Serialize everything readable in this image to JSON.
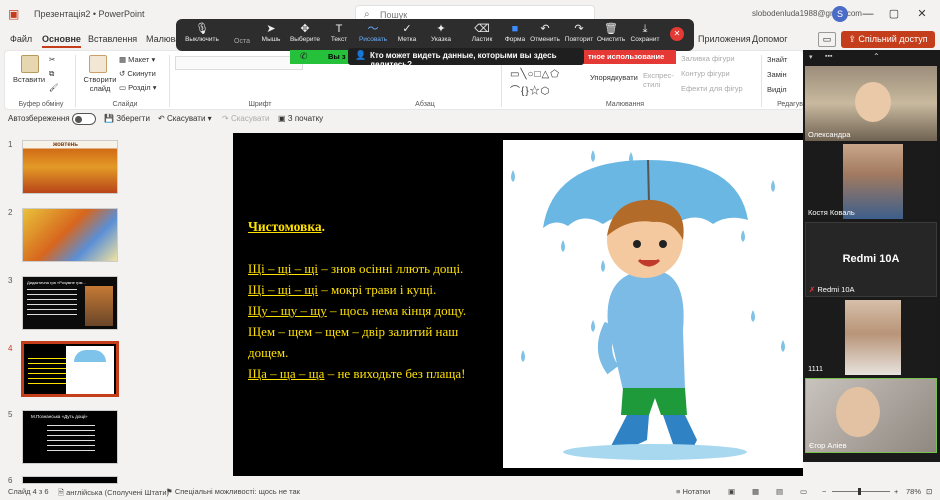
{
  "titlebar": {
    "doc_title": "Презентація2 • PowerPoint",
    "search_placeholder": "Пошук",
    "user_email": "slobodenluda1988@gmail.com",
    "avatar_letter": "S",
    "minimize": "—",
    "maximize": "▢",
    "close": "✕"
  },
  "tabs": [
    "Файл",
    "Основне",
    "Вставлення",
    "Малюва",
    "Приложения",
    "Допомог"
  ],
  "tabs_partial": {
    "ostavit": "Оста",
    "vyklyuchyty": "Выключить"
  },
  "share_label": "Спільний доступ",
  "comment_icon": "comment-icon",
  "zoom_toolbar": {
    "items": [
      {
        "label": "Мышь",
        "icon": "cursor-icon"
      },
      {
        "label": "Выберите",
        "icon": "move-icon"
      },
      {
        "label": "Текст",
        "icon": "text-icon"
      },
      {
        "label": "Рисовать",
        "icon": "draw-icon"
      },
      {
        "label": "Метка",
        "icon": "checkmark-icon"
      },
      {
        "label": "Указка",
        "icon": "pointer-icon"
      },
      {
        "label": "Ластик",
        "icon": "eraser-icon"
      },
      {
        "label": "Форма",
        "icon": "shape-icon"
      },
      {
        "label": "Отменить",
        "icon": "undo-icon"
      },
      {
        "label": "Повторит",
        "icon": "redo-icon"
      },
      {
        "label": "Очистить",
        "icon": "trash-icon"
      },
      {
        "label": "Сохранит",
        "icon": "save-icon"
      }
    ],
    "question": "Кто может видеть данные, которыми вы здесь делитесь?",
    "green_text": "Вы з",
    "red_text": "тное использование"
  },
  "ribbon": {
    "paste": "Вставити",
    "clipboard_label": "Буфер обміну",
    "new_slide": "Створити слайд",
    "layout": "Макет",
    "reset": "Скинути",
    "section": "Розділ",
    "slides_label": "Слайди",
    "font_label": "Шрифт",
    "paragraph_label": "Абзац",
    "arrange": "Упорядкувати",
    "express_styles": "Експрес-стилі",
    "drawing_label": "Малювання",
    "fill": "Заливка фігури",
    "outline": "Контур фігури",
    "effects": "Ефекти для фігур",
    "find": "Знайт",
    "replace": "Замін",
    "select": "Виділ",
    "editing_label": "Редагув"
  },
  "qat": {
    "autosave": "Автозбереження",
    "save": "Зберегти",
    "undo": "Скасувати",
    "redo": "Скасувати",
    "from_start": "З початку"
  },
  "thumbnails": [
    {
      "num": "1",
      "caption": "жовтень"
    },
    {
      "num": "2",
      "caption": ""
    },
    {
      "num": "3",
      "caption": "Дидактична гра «Розумне грм..."
    },
    {
      "num": "4",
      "caption": ""
    },
    {
      "num": "5",
      "caption": "М.Познанська «Дуть дощі»"
    },
    {
      "num": "6",
      "caption": ""
    }
  ],
  "slide": {
    "title": "Чистомовка",
    "title_dot": ".",
    "lines": [
      {
        "u": "Щі – щі – щі",
        "rest": " – знов осінні ллють дощі."
      },
      {
        "u": "Щі – щі – щі",
        "rest": " – мокрі трави і кущі."
      },
      {
        "u": "Щу – щу – щу",
        "rest": " – щось нема кінця дощу."
      },
      {
        "u": "",
        "rest": "Щем – щем – щем – двір залитий наш"
      },
      {
        "u": "",
        "rest": "дощем."
      },
      {
        "u": "Ща – ща – ща",
        "rest": " – не виходьте без плаща!"
      }
    ]
  },
  "video": [
    {
      "name": "Олександра"
    },
    {
      "name": "Костя Коваль"
    },
    {
      "name": "Redmi 10A",
      "center": "Redmi 10A"
    },
    {
      "name": "1111"
    },
    {
      "name": "Єгор Аліев"
    }
  ],
  "statusbar": {
    "slide_of": "Слайд 4 з 6",
    "language": "англійська (Сполучені Штати)",
    "accessibility": "Спеціальні можливості: щось не так",
    "notes": "Нотатки",
    "zoom": "78%"
  }
}
